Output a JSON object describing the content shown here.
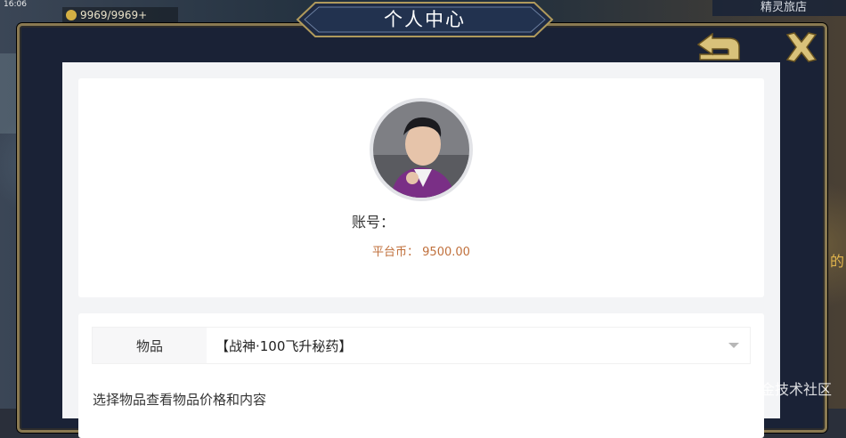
{
  "status": {
    "time": "16:06",
    "gold": "9969/9969+"
  },
  "shop_button": "精灵旅店",
  "dialog": {
    "title": "个人中心"
  },
  "profile": {
    "account_label": "账号：",
    "account_value": "",
    "coins_label": "平台币：",
    "coins_value": "9500.00"
  },
  "items": {
    "label": "物品",
    "selected": "【战神·100飞升秘药】",
    "hint": "选择物品查看物品价格和内容"
  },
  "side_text": "的",
  "watermark": "@稀土掘金技术社区",
  "colors": {
    "coins": "#c0703c",
    "frame_gold": "#8a7a52",
    "dialog_bg": "#1a2236"
  },
  "icons": {
    "back": "return-arrow-icon",
    "close": "close-x-icon",
    "dropdown": "caret-down-icon",
    "gold": "coin-icon"
  }
}
